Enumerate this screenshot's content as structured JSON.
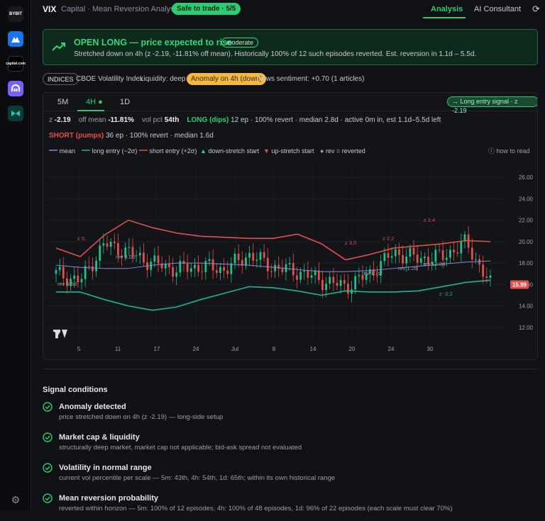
{
  "sidebar": {
    "apps": [
      {
        "name": "BYBIT",
        "color": "#ffffff"
      },
      {
        "name": "kraken-m",
        "color": "#1a73e8"
      },
      {
        "name": "capital.com",
        "color": "#ffffff"
      },
      {
        "name": "kraken",
        "color": "#7b61ff"
      },
      {
        "name": "bitvavo-like",
        "color": "#2ec4b6"
      }
    ]
  },
  "header": {
    "ticker": "VIX",
    "subtitle": "Capital · Mean Reversion Analysis",
    "safe_badge": "Safe to trade · 5/5",
    "tabs": [
      "Analysis",
      "AI Consultant"
    ]
  },
  "alert": {
    "title": "OPEN LONG — price expected to rise",
    "pill": "moderate",
    "text": "Stretched down on 4h (z -2.19, -11.81% off mean). Historically 100% of 12 such episodes reverted. Est. reversion in 1.1d – 5.5d."
  },
  "info_row": {
    "category": "INDICES",
    "name": "CBOE Volatility Index",
    "liquidity": "Liquidity: deep",
    "anomaly": "Anomaly on 4h (down)",
    "sentiment": "News sentiment: +0.70 (1 articles)"
  },
  "chart": {
    "tf_tabs": [
      "5M",
      "4H",
      "1D"
    ],
    "signal_pill": "Long entry signal · z -2.19",
    "z_label": "z",
    "z_value": "-2.19",
    "off_mean_label": "off mean",
    "off_mean_value": "-11.81%",
    "vol_pct_label": "vol pct",
    "vol_pct_value": "54th",
    "long_label": "LONG (dips)",
    "long_text": "12 ep · 100% revert · median 2.8d · active 0m in, est 1.1d–5.5d left",
    "short_label": "SHORT (pumps)",
    "short_text": "36 ep · 100% revert · median 1.6d",
    "legend": [
      "mean",
      "long entry (−2σ)",
      "short entry (+2σ)",
      "down-stretch start",
      "up-stretch start",
      "rev = reverted",
      "how to read"
    ],
    "price_tag": "15.99",
    "annotations": [
      "z 5.",
      "rev 3.0d",
      "rev 5.5d",
      "z 3.0",
      "z 2.2",
      "z 2.4",
      "rev 1.7d",
      "rev 1.2d",
      "rev 12.0d",
      "z -2.2"
    ]
  },
  "chart_data": {
    "type": "line",
    "title": "",
    "x_ticks": [
      "5",
      "11",
      "17",
      "24",
      "Jul",
      "8",
      "14",
      "20",
      "24",
      "30"
    ],
    "y_ticks": [
      12.0,
      14.0,
      16.0,
      18.0,
      20.0,
      22.0,
      24.0,
      26.0
    ],
    "ylim": [
      11.0,
      27.0
    ],
    "series": [
      {
        "name": "mean",
        "color": "#8b87d8",
        "values": [
          17.8,
          17.6,
          17.5,
          17.5,
          17.8,
          18.0,
          18.0,
          17.9,
          17.8,
          17.6,
          17.4,
          17.2,
          17.2,
          17.3,
          17.5,
          17.7,
          17.9,
          18.1,
          18.2
        ]
      },
      {
        "name": "long entry (−2σ)",
        "color": "#1fb39a",
        "values": [
          15.3,
          15.3,
          14.6,
          14.0,
          13.6,
          13.9,
          14.6,
          15.2,
          15.8,
          15.7,
          15.4,
          15.0,
          15.4,
          15.3,
          15.3,
          15.4,
          15.8,
          16.2,
          16.4
        ]
      },
      {
        "name": "short entry (+2σ)",
        "color": "#e2504a",
        "values": [
          19.4,
          18.6,
          20.6,
          22.0,
          21.3,
          20.8,
          20.5,
          20.4,
          20.3,
          20.3,
          20.7,
          19.8,
          18.3,
          18.8,
          19.4,
          19.6,
          19.8,
          20.1,
          20.0
        ]
      },
      {
        "name": "price",
        "color": "#22c08a",
        "values": [
          17.0,
          16.3,
          19.8,
          19.0,
          18.0,
          17.4,
          17.7,
          17.4,
          18.8,
          17.6,
          17.2,
          16.4,
          15.8,
          17.0,
          19.0,
          18.4,
          18.6,
          19.9,
          15.99
        ]
      }
    ],
    "legend_position": "top",
    "grid": true
  },
  "signal_conditions": {
    "title": "Signal conditions",
    "items": [
      {
        "title": "Anomaly detected",
        "desc": "price stretched down on 4h (z -2.19) — long-side setup"
      },
      {
        "title": "Market cap & liquidity",
        "desc": "structurally deep market, market cap not applicable; bid-ask spread not evaluated"
      },
      {
        "title": "Volatility in normal range",
        "desc": "current vol percentile per scale — 5m: 43th, 4h: 54th, 1d: 65th; within its own historical range"
      },
      {
        "title": "Mean reversion probability",
        "desc": "reverted within horizon — 5m: 100% of 12 episodes, 4h: 100% of 48 episodes, 1d: 96% of 22 episodes (each scale must clear 70%)"
      }
    ]
  },
  "colors": {
    "accent_green": "#2ecc71",
    "amber": "#f5b942",
    "danger": "#e2504a",
    "teal": "#1fb39a"
  }
}
